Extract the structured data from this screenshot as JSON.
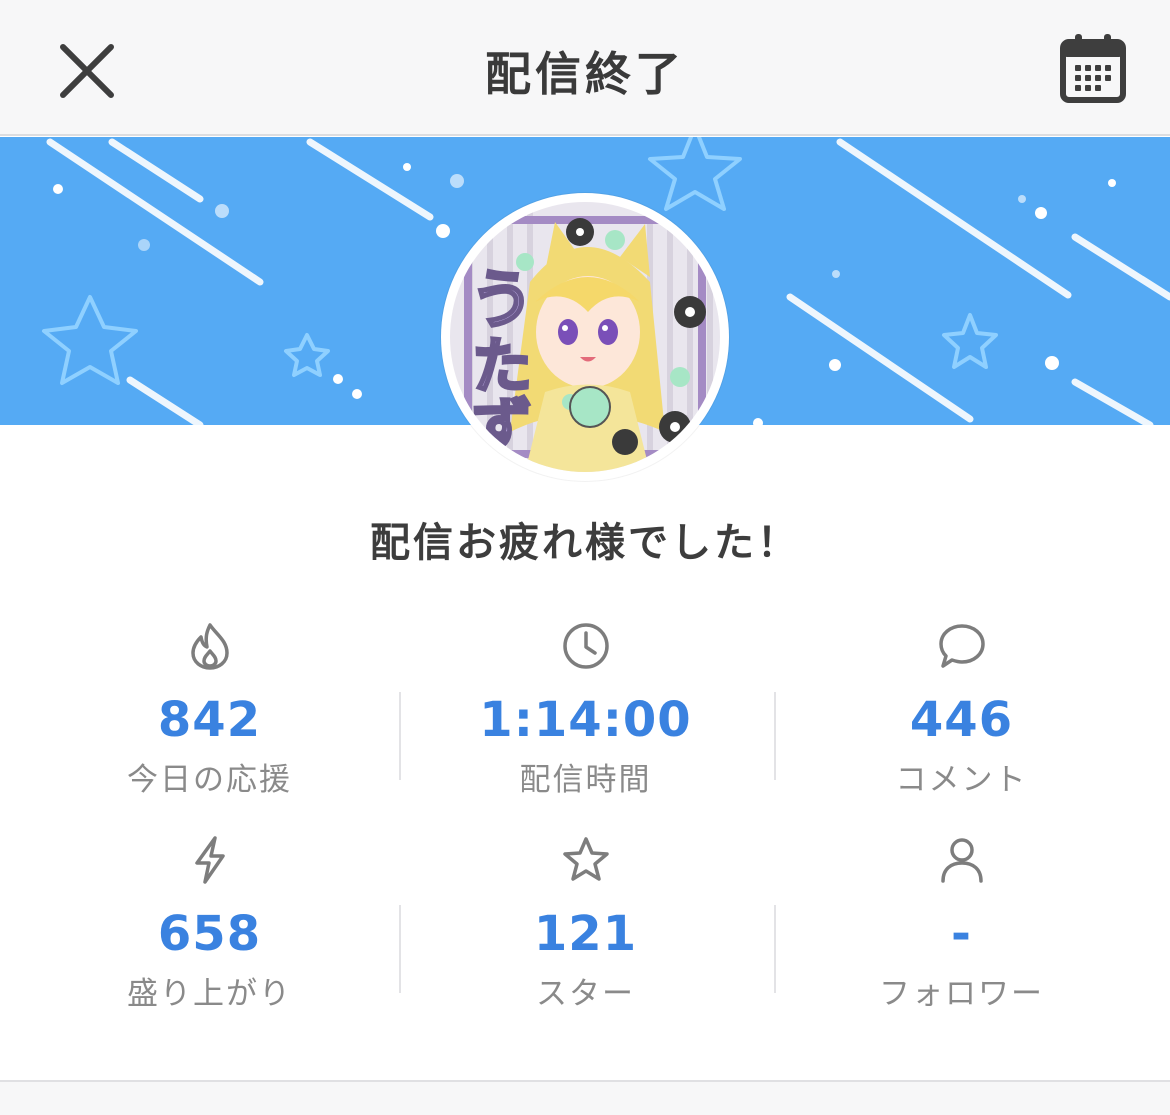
{
  "header": {
    "title": "配信終了",
    "close_icon": "close-icon",
    "calendar_icon": "calendar-icon"
  },
  "banner": {
    "background_color": "#55aaf4"
  },
  "message": "配信お疲れ様でした！",
  "stats": [
    {
      "icon": "flame-icon",
      "value": "842",
      "label": "今日の応援"
    },
    {
      "icon": "clock-icon",
      "value": "1:14:00",
      "label": "配信時間"
    },
    {
      "icon": "speech-bubble-icon",
      "value": "446",
      "label": "コメント"
    },
    {
      "icon": "lightning-icon",
      "value": "658",
      "label": "盛り上がり"
    },
    {
      "icon": "star-icon",
      "value": "121",
      "label": "スター"
    },
    {
      "icon": "person-icon",
      "value": "-",
      "label": "フォロワー"
    }
  ],
  "colors": {
    "accent": "#3a82e0",
    "label": "#8a8a8a"
  }
}
